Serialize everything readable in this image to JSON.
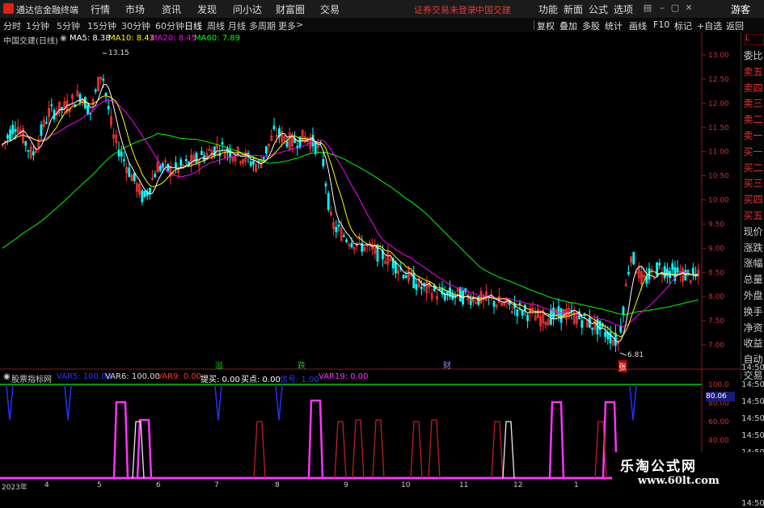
{
  "app": {
    "title": "通达信金融终端"
  },
  "menu": [
    "行情",
    "市场",
    "资讯",
    "发现",
    "问小达",
    "财富圈",
    "交易"
  ],
  "warning": "证券交易未登录",
  "warning_stock": "中国交建",
  "right_menu": [
    "功能",
    "新面",
    "公式",
    "选项"
  ],
  "guest": "游客",
  "timeframes": [
    "分时",
    "1分钟",
    "5分钟",
    "15分钟",
    "30分钟",
    "60分钟",
    "日线",
    "周线",
    "月线",
    "多周期",
    "更多"
  ],
  "toolbar_right": [
    "复权",
    "叠加",
    "多股",
    "统计",
    "画线",
    "F10",
    "标记",
    "+自选",
    "返回"
  ],
  "stock_label": "中国交建(日线)",
  "ma": {
    "ma5": "MA5: 8.38",
    "ma10": "MA10: 8.43",
    "ma20": "MA20: 8.45",
    "ma60": "MA60: 7.89"
  },
  "price_high": "13.15",
  "price_low": "6.81",
  "y_ticks": [
    "13.00",
    "12.50",
    "12.00",
    "11.50",
    "11.00",
    "10.50",
    "10.00",
    "9.50",
    "9.00",
    "8.50",
    "8.00",
    "7.50",
    "7.00"
  ],
  "side_panel": [
    "委比",
    "卖五",
    "卖四",
    "卖三",
    "卖二",
    "卖一",
    "买一",
    "买二",
    "买三",
    "买四",
    "买五",
    "现价",
    "涨跌",
    "涨幅",
    "总量",
    "外盘",
    "换手",
    "净资",
    "收益",
    "自动",
    "交易"
  ],
  "side_times": [
    "14:50",
    "14:50",
    "14:50",
    "14:50",
    "14:50",
    "14:50",
    "14:50",
    "14:50",
    "14:50"
  ],
  "markers": {
    "m1": "溢",
    "m2": "跌",
    "m3": "财",
    "m4": "张"
  },
  "indicator": {
    "name": "股票指标网",
    "var5": "VAR5: 100.00",
    "var6": "VAR6: 100.00",
    "var9": "VAR9: 0.00",
    "tixian": "提买: 0.00",
    "maidian": "买点: 0.00",
    "xinhao": "信号: 1.00",
    "var19": "VAR19: 0.00",
    "y_ticks": [
      "100.0",
      "80.00",
      "60.00",
      "40.00",
      "20.00"
    ],
    "current": "80.06"
  },
  "dates": [
    "2023年",
    "4",
    "5",
    "6",
    "7",
    "8",
    "9",
    "10",
    "11",
    "12",
    "1"
  ],
  "watermark": {
    "line1": "乐淘公式网",
    "line2": "www.60lt.com"
  },
  "colors": {
    "up": "#ff3333",
    "down": "#00ffff",
    "ma5": "#ffffff",
    "ma10": "#ffff00",
    "ma20": "#ff00ff",
    "ma60": "#00ff00",
    "indicator": "#ff33ff"
  }
}
